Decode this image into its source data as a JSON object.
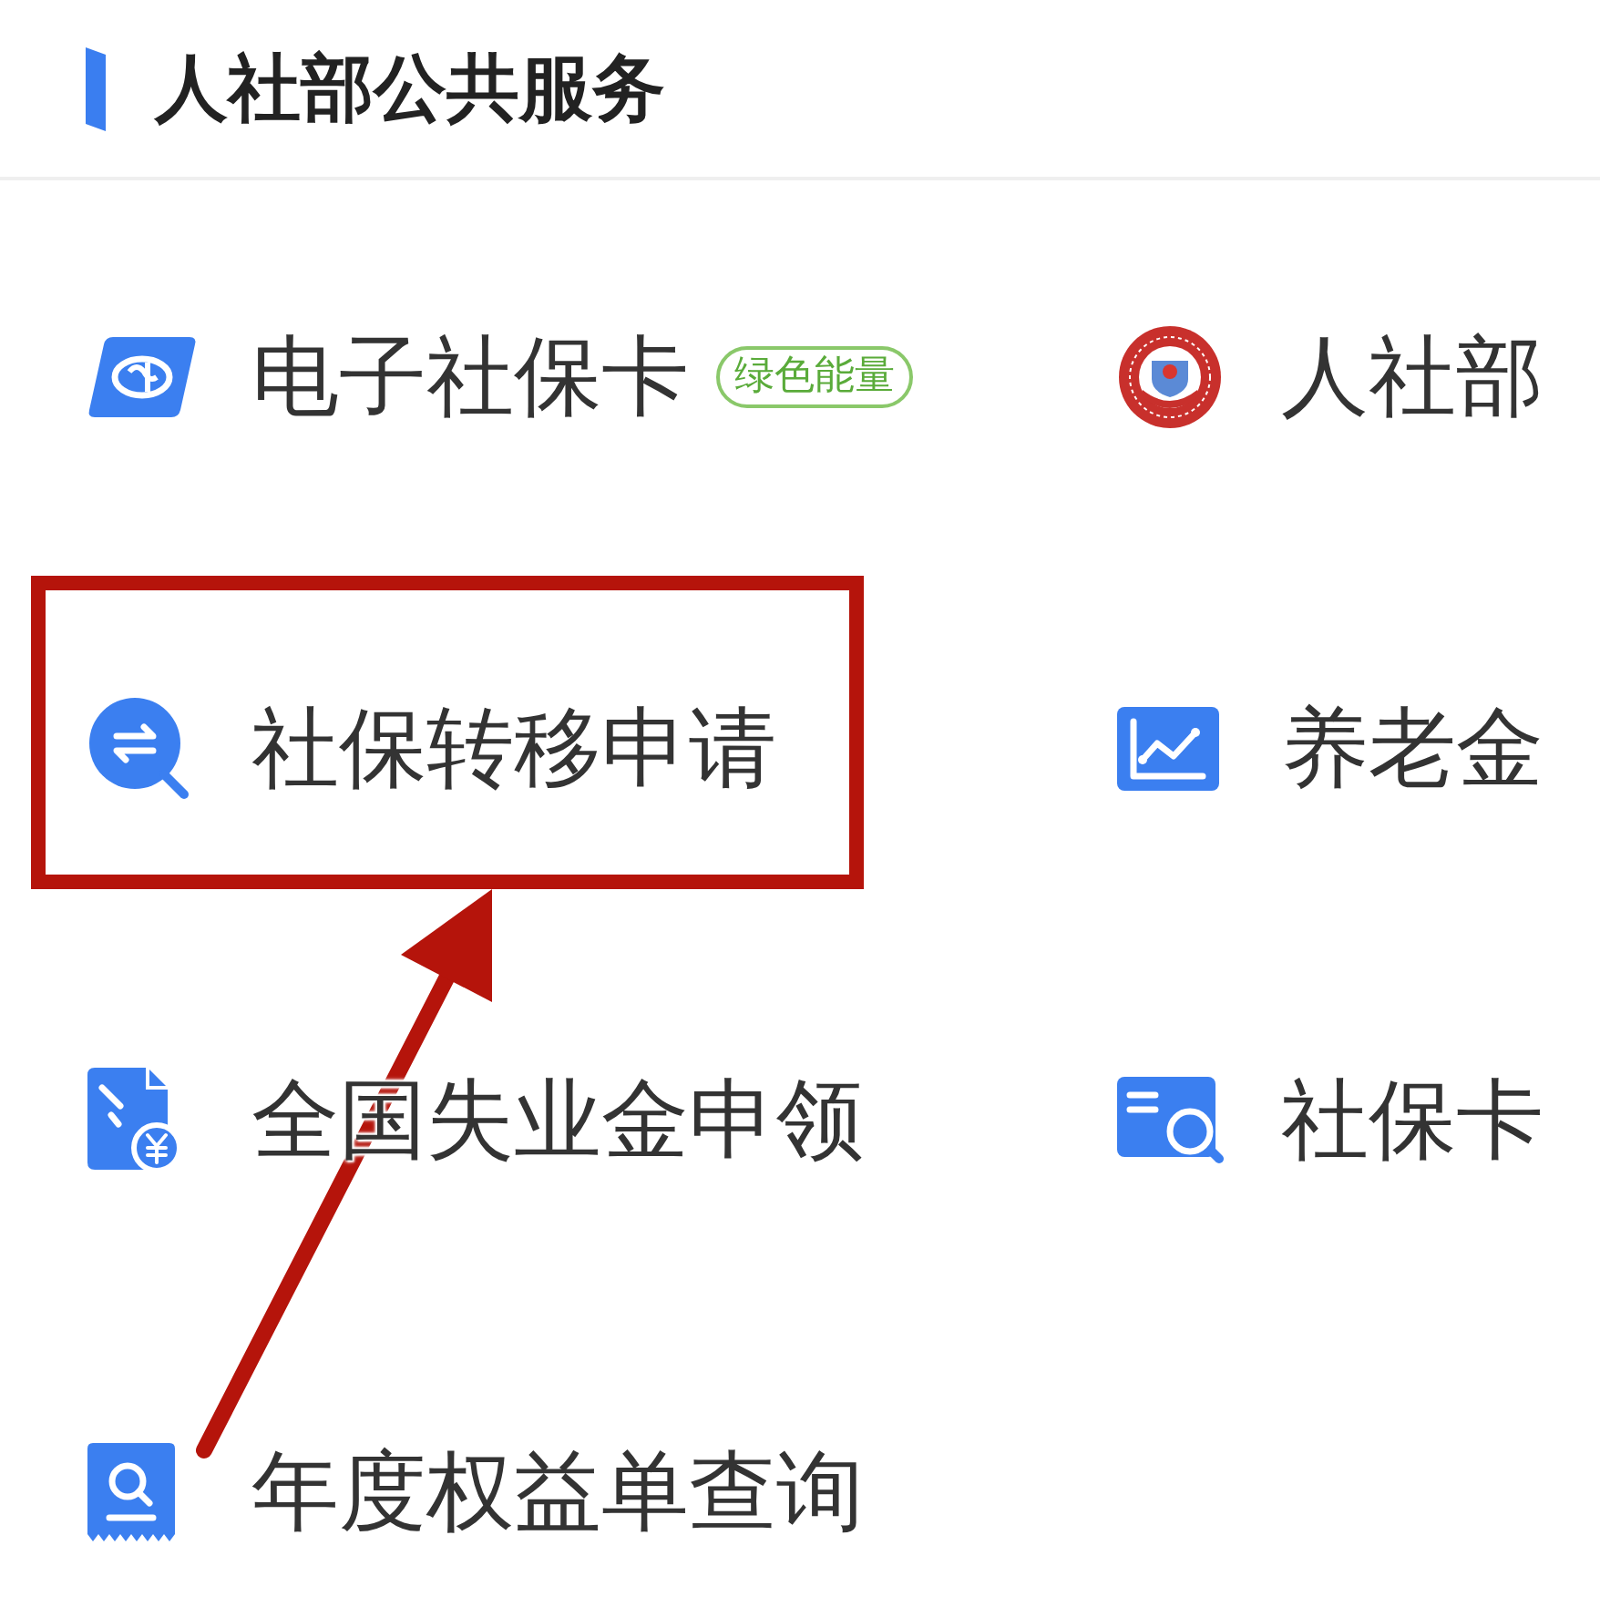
{
  "section": {
    "title": "人社部公共服务"
  },
  "services": [
    {
      "label": "电子社保卡",
      "badge": "绿色能量",
      "highlighted": false
    },
    {
      "label": "人社部",
      "highlighted": false
    },
    {
      "label": "社保转移申请",
      "highlighted": true
    },
    {
      "label": "养老金",
      "highlighted": false
    },
    {
      "label": "全国失业金申领",
      "highlighted": false
    },
    {
      "label": "社保卡",
      "highlighted": false
    },
    {
      "label": "年度权益单查询",
      "highlighted": false
    }
  ]
}
